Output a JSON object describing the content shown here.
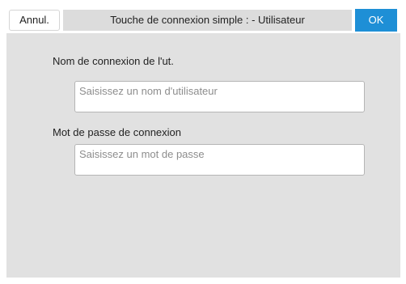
{
  "header": {
    "cancel_label": "Annul.",
    "title": "Touche de connexion simple :  - Utilisateur",
    "ok_label": "OK"
  },
  "form": {
    "username": {
      "label": "Nom de connexion de l'ut.",
      "value": "",
      "placeholder": "Saisissez un nom d'utilisateur"
    },
    "password": {
      "label": "Mot de passe de connexion",
      "value": "",
      "placeholder": "Saisissez un mot de passe"
    }
  },
  "colors": {
    "accent": "#1e8fd6",
    "panel_background": "#e1e1e1"
  }
}
